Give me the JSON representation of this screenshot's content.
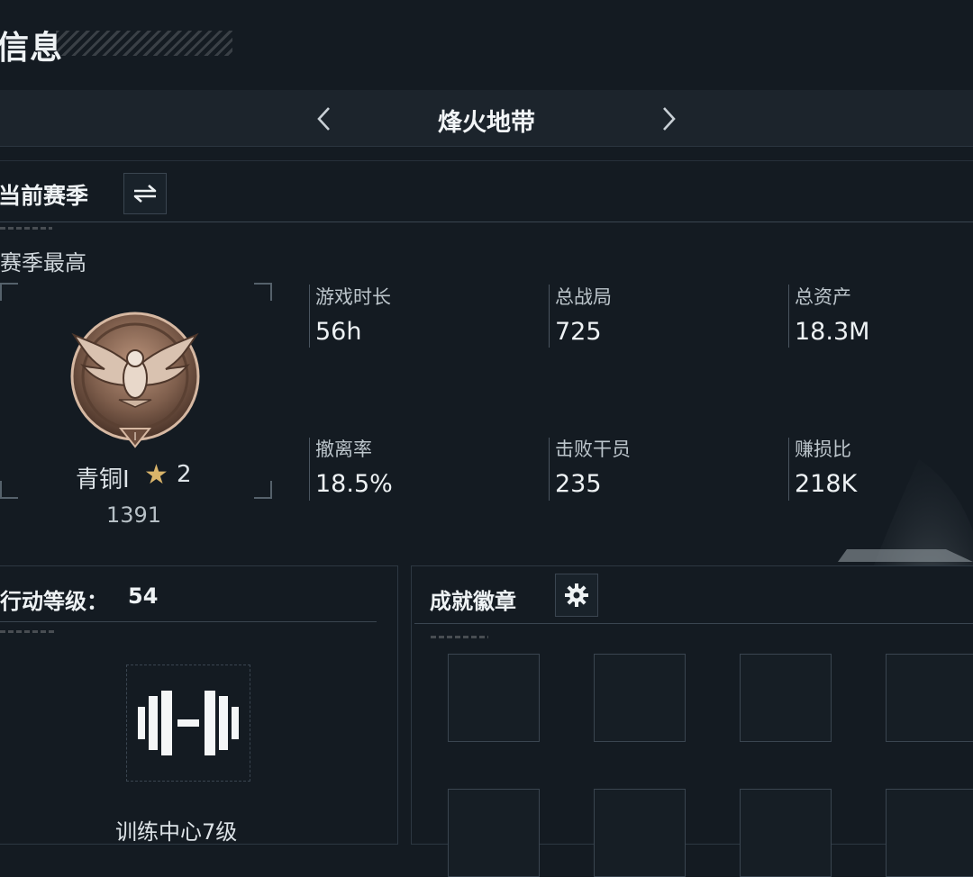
{
  "page": {
    "title": "信息"
  },
  "game_selector": {
    "title": "烽火地带",
    "prev_icon": "chevron-left-icon",
    "next_icon": "chevron-right-icon"
  },
  "season": {
    "label": "当前赛季",
    "switch_icon": "swap-icon",
    "best_label": "赛季最高",
    "rank": {
      "name": "青铜Ⅰ",
      "star_icon": "star-icon",
      "star_color": "#d9b46a",
      "stars": "2",
      "score": "1391",
      "badge_icon": "eagle-rank-emblem-icon"
    },
    "stats": [
      {
        "label": "游戏时长",
        "value": "56h"
      },
      {
        "label": "总战局",
        "value": "725"
      },
      {
        "label": "总资产",
        "value": "18.3M"
      },
      {
        "label": "撤离率",
        "value": "18.5%"
      },
      {
        "label": "击败干员",
        "value": "235"
      },
      {
        "label": "赚损比",
        "value": "218K"
      }
    ]
  },
  "action_level": {
    "label": "行动等级：",
    "value": "54",
    "icon": "dumbbell-icon",
    "training_label": "训练中心7级"
  },
  "badges": {
    "title": "成就徽章",
    "settings_icon": "gear-icon"
  },
  "colors": {
    "background": "#141b22",
    "bar": "#1c242c",
    "accent_bronze": "#8b6a55"
  }
}
